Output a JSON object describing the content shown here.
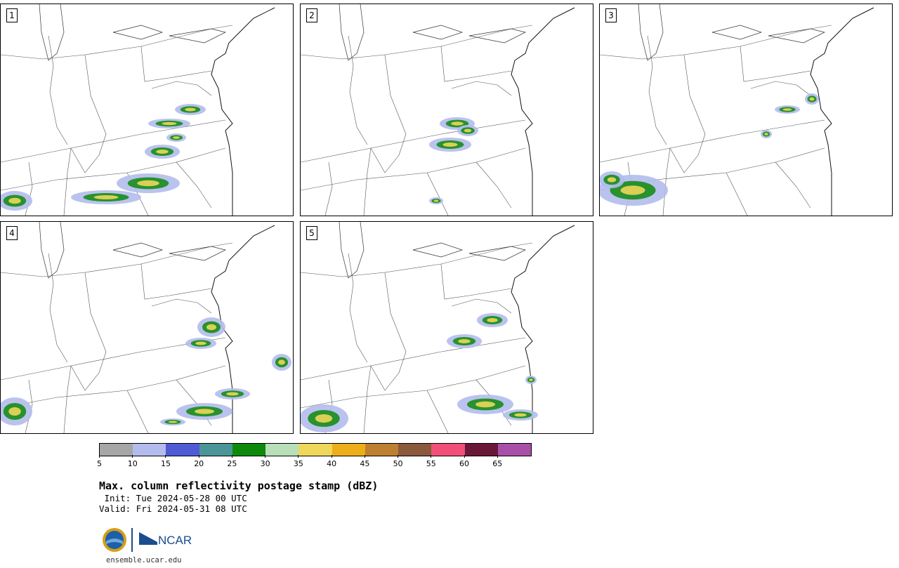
{
  "product": {
    "title": "Max. column reflectivity postage stamp (dBZ)",
    "init": " Init: Tue 2024-05-28 00 UTC",
    "valid": "Valid: Fri 2024-05-31 08 UTC",
    "website": "ensemble.ucar.edu",
    "logos": [
      "NSF",
      "NCAR"
    ]
  },
  "panels": [
    {
      "label": "1"
    },
    {
      "label": "2"
    },
    {
      "label": "3"
    },
    {
      "label": "4"
    },
    {
      "label": "5"
    }
  ],
  "colorbar": {
    "ticks": [
      "5",
      "10",
      "15",
      "20",
      "25",
      "30",
      "35",
      "40",
      "45",
      "50",
      "55",
      "60",
      "65"
    ],
    "colors": [
      "#a6a6a6",
      "#b3bcec",
      "#4f5bd5",
      "#4b9598",
      "#0d8a0c",
      "#b8dfb8",
      "#eed75a",
      "#ecae1a",
      "#bd8032",
      "#8a5a3c",
      "#f05078",
      "#6a1838",
      "#a850a8"
    ]
  }
}
